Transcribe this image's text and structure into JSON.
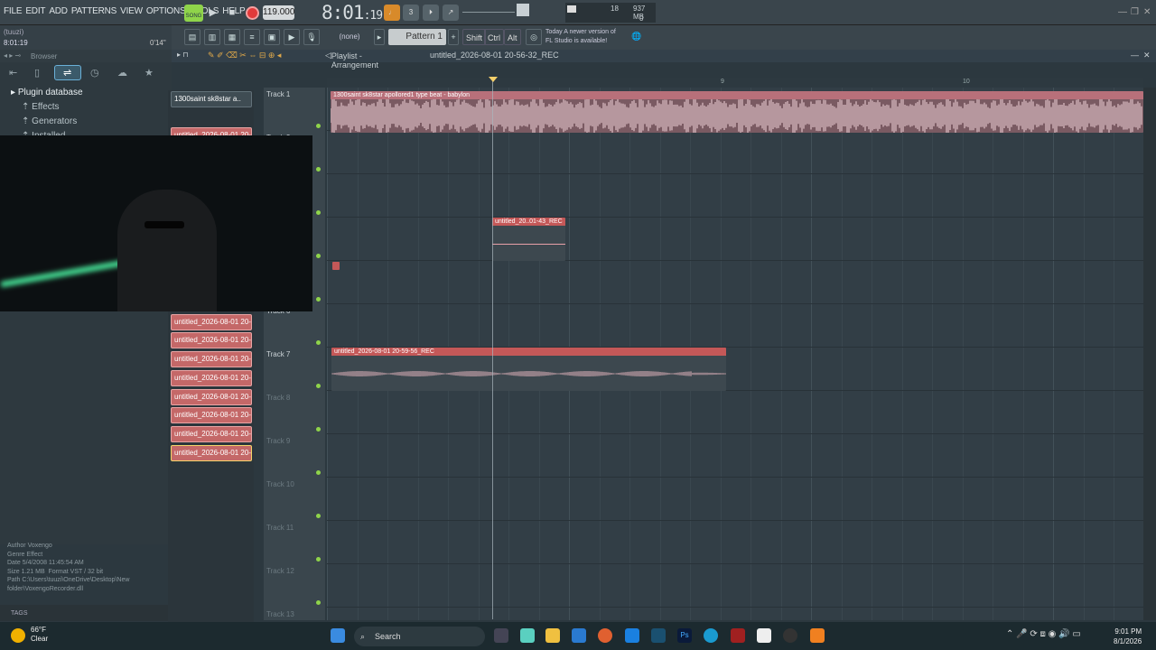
{
  "menu": [
    "FILE",
    "EDIT",
    "ADD",
    "PATTERNS",
    "VIEW",
    "OPTIONS",
    "TOOLS",
    "HELP"
  ],
  "transport": {
    "song_label": "SONG",
    "tempo": "119.000",
    "time_main": "8:01",
    "time_sub": ":19"
  },
  "cpu": {
    "cpu_value": "18",
    "memory": "937 MB",
    "voices": "0"
  },
  "hint": {
    "line1": "(tuuzi)",
    "line2": "8:01:19",
    "line3": "0'14\""
  },
  "toolbar": {
    "none_label": "(none)",
    "pattern_label": "Pattern 1",
    "shift": "Shift",
    "ctrl": "Ctrl",
    "alt": "Alt",
    "news_line1": "Today  A newer version of",
    "news_line2": "FL Studio is available!"
  },
  "browser": {
    "title": "Browser",
    "root": "Plugin database",
    "effects": "Effects",
    "generators": "Generators",
    "installed": "Installed",
    "info": {
      "author": "Voxengo",
      "genre": "Effect",
      "date": "5/4/2008 11:45:54 AM",
      "size": "1.21 MB",
      "format": "VST / 32 bit",
      "path": "C:\\Users\\tuuzi\\OneDrive\\Desktop\\New folder\\VoxengoRecorder.dll"
    },
    "tags": "TAGS"
  },
  "channels": [
    "1300saint  sk8star  a..",
    "untitled_2026-08-01 20-",
    "untitled_2026-08-01 20-",
    "untitled_2026-08-01 20-",
    "untitled_2026-08-01 20-",
    "untitled_2026-08-01 20-",
    "untitled_2026-08-01 20-",
    "untitled_2026-08-01 20-",
    "untitled_2026-08-01 20-",
    "untitled_2026-08-01 20-",
    "untitled_2026-08-01 20-",
    "untitled_2026-08-01 20-",
    "untitled_2026-08-01 20-",
    "untitled_2026-08-01 20-",
    "untitled_2026-08-01 20-",
    "untitled_2026-08-01 20-",
    "untitled_2026-08-01 20-",
    "untitled_2026-08-01 20-",
    "untitled_2026-08-01 20-"
  ],
  "playlist": {
    "title": "Playlist - Arrangement",
    "project": "untitled_2026-08-01 20-56-32_REC",
    "ruler": [
      "8",
      "9",
      "10"
    ],
    "tracks": [
      "Track 1",
      "Track 2",
      "Track 3",
      "Track 4",
      "Track 5",
      "Track 6",
      "Track 7",
      "Track 8",
      "Track 9",
      "Track 10",
      "Track 11",
      "Track 12",
      "Track 13"
    ],
    "clips": {
      "clip1": "1300saint  sk8star  apollored1 type beat - babylon",
      "clip2": "untitled_20..01-43_REC",
      "clip3": "untitled_2026-08-01 20-59-56_REC"
    }
  },
  "taskbar": {
    "temp": "66°F",
    "weather": "Clear",
    "search": "Search",
    "time": "9:01 PM",
    "date": "8/1/2026"
  }
}
